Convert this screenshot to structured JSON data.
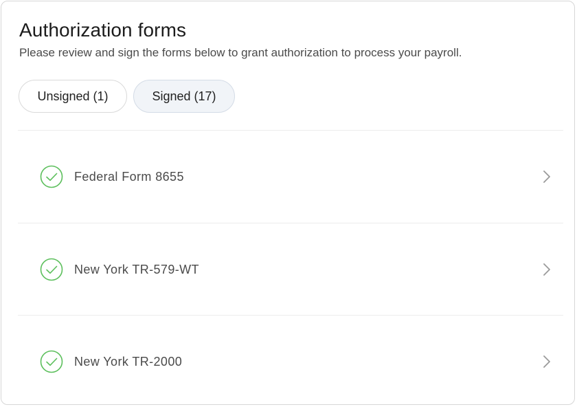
{
  "header": {
    "title": "Authorization forms",
    "subtitle": "Please review and sign the forms below to grant authorization to process your payroll."
  },
  "tabs": [
    {
      "label": "Unsigned (1)",
      "selected": false
    },
    {
      "label": "Signed (17)",
      "selected": true
    }
  ],
  "forms": [
    {
      "label": "Federal Form 8655",
      "status_icon": "check-circle-icon"
    },
    {
      "label": "New York TR-579-WT",
      "status_icon": "check-circle-icon"
    },
    {
      "label": "New York TR-2000",
      "status_icon": "check-circle-icon"
    }
  ],
  "colors": {
    "check_green": "#5cbf5c",
    "chevron_gray": "#9a9a9a",
    "selected_tab_bg": "#f1f4f8"
  }
}
